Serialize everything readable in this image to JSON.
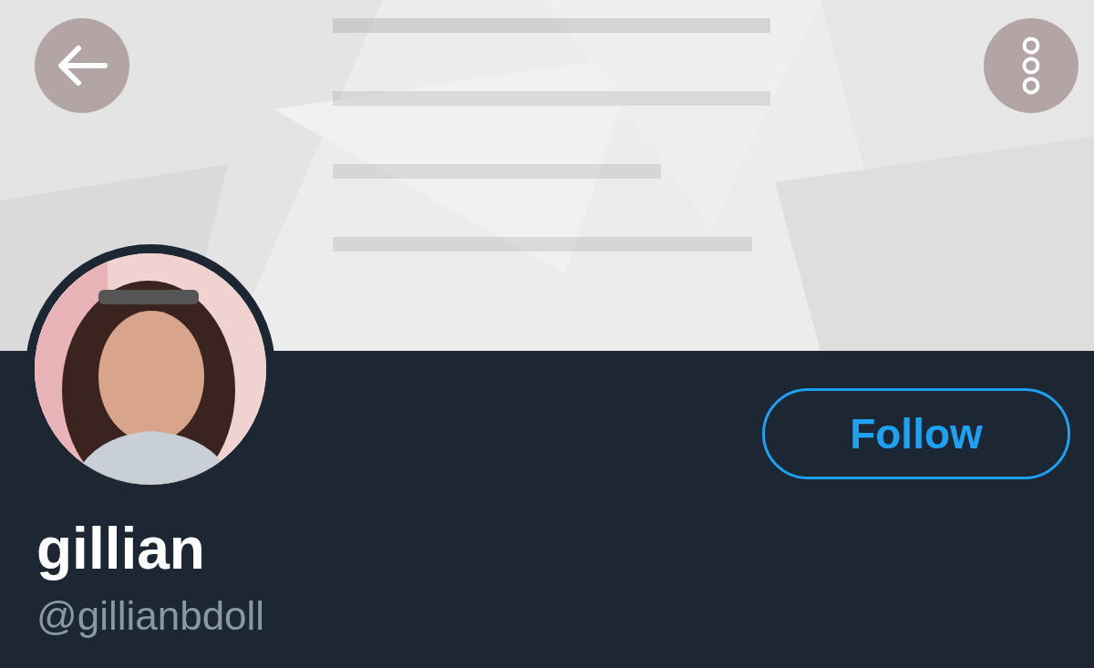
{
  "profile": {
    "name": "gillian",
    "handle": "@gillianbdoll"
  },
  "follow_button": {
    "label": "Follow"
  }
}
